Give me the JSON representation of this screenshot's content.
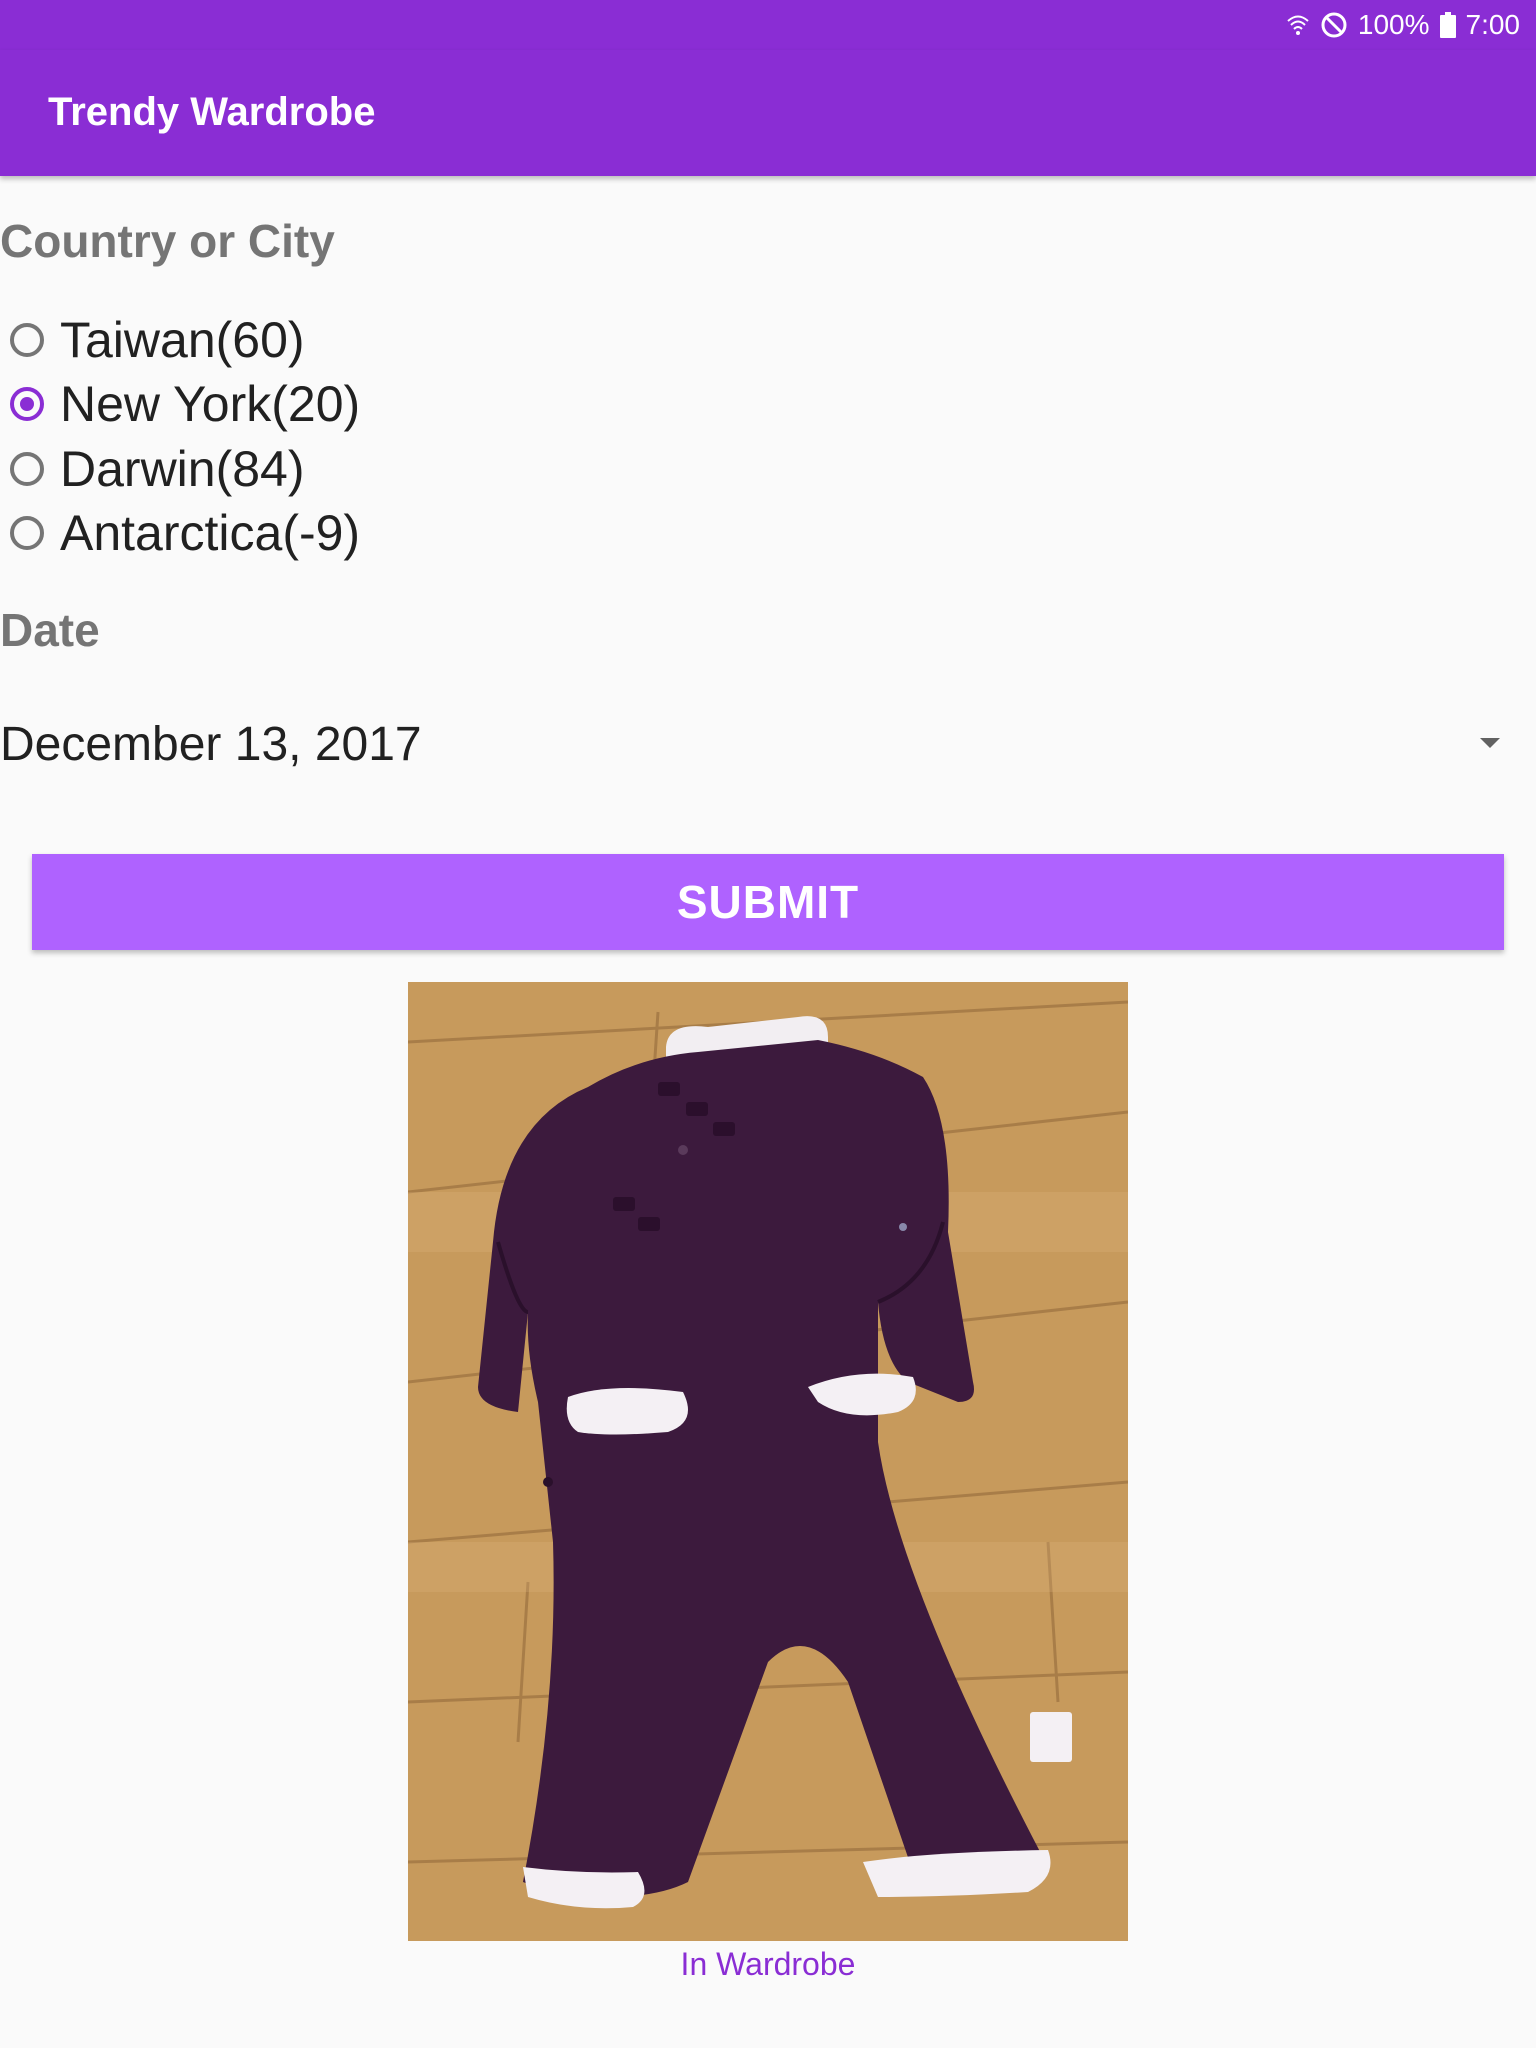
{
  "status_bar": {
    "battery": "100%",
    "time": "7:00"
  },
  "app_bar": {
    "title": "Trendy Wardrobe"
  },
  "location": {
    "label": "Country or City",
    "options": [
      {
        "label": "Taiwan(60)",
        "checked": false
      },
      {
        "label": "New York(20)",
        "checked": true
      },
      {
        "label": "Darwin(84)",
        "checked": false
      },
      {
        "label": "Antarctica(-9)",
        "checked": false
      }
    ]
  },
  "date": {
    "label": "Date",
    "selected": "December 13, 2017"
  },
  "submit": {
    "label": "SUBMIT"
  },
  "result": {
    "image_subject": "purple long-sleeve baby romper with white cuffs on a wooden floor",
    "caption": "In Wardrobe"
  },
  "colors": {
    "primary": "#8a2dd4",
    "button": "#af62ff",
    "label_gray": "#757575",
    "background": "#fafafa"
  }
}
